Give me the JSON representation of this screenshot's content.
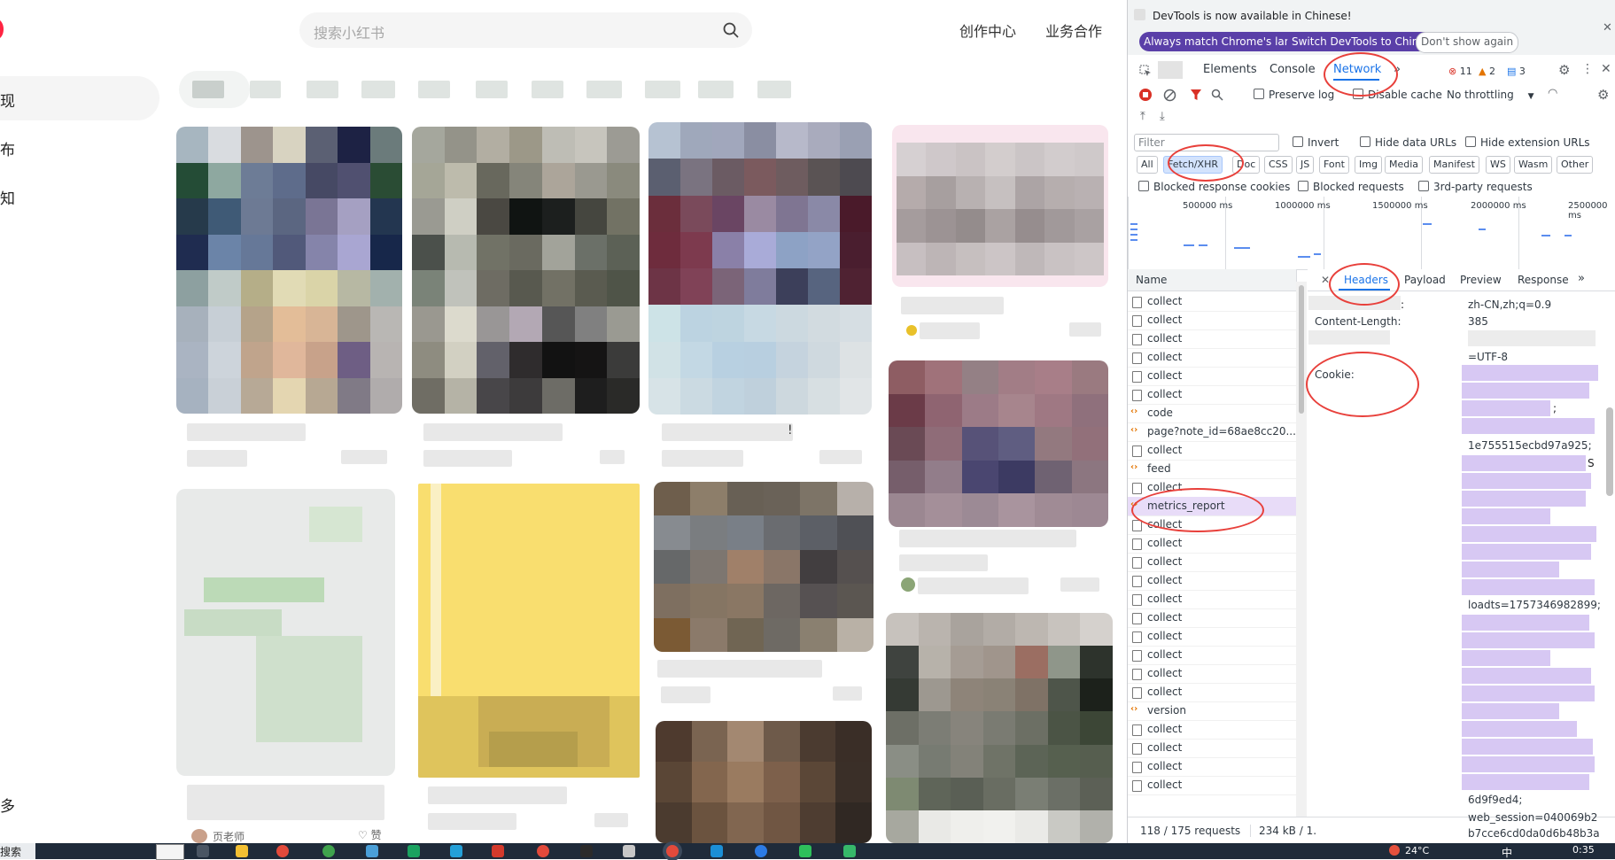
{
  "web": {
    "search": {
      "placeholder": "搜索小红书"
    },
    "top_links": [
      "创作中心",
      "业务合作"
    ],
    "sidebar_fragments": [
      "现",
      "布",
      "知",
      "多"
    ],
    "card_fragments": [
      "!",
      "页老师",
      "赞"
    ]
  },
  "devtools": {
    "infobar": {
      "message": "DevTools is now available in Chinese!",
      "btn_match": "Always match Chrome's language",
      "btn_switch": "Switch DevTools to Chinese",
      "btn_dont": "Don't show again",
      "close": "✕"
    },
    "tabs": {
      "elements": "Elements",
      "console": "Console",
      "network": "Network",
      "more": "»"
    },
    "badges": {
      "errors": "11",
      "warnings": "2",
      "messages": "3"
    },
    "toolbar": {
      "preserve_log": "Preserve log",
      "disable_cache": "Disable cache",
      "throttling": "No throttling"
    },
    "filter": {
      "placeholder": "Filter",
      "invert": "Invert",
      "hide_data_urls": "Hide data URLs",
      "hide_ext_urls": "Hide extension URLs",
      "types": [
        "All",
        "Fetch/XHR",
        "Doc",
        "CSS",
        "JS",
        "Font",
        "Img",
        "Media",
        "Manifest",
        "WS",
        "Wasm",
        "Other"
      ],
      "blocked_cookies": "Blocked response cookies",
      "blocked_requests": "Blocked requests",
      "third_party": "3rd-party requests"
    },
    "timeline_ticks": [
      "500000 ms",
      "1000000 ms",
      "1500000 ms",
      "2000000 ms",
      "2500000 ms"
    ],
    "requests": {
      "column": "Name",
      "rows": [
        {
          "name": "collect",
          "type": "doc"
        },
        {
          "name": "collect",
          "type": "doc"
        },
        {
          "name": "collect",
          "type": "doc"
        },
        {
          "name": "collect",
          "type": "doc"
        },
        {
          "name": "collect",
          "type": "doc"
        },
        {
          "name": "collect",
          "type": "doc"
        },
        {
          "name": "code",
          "type": "xhr"
        },
        {
          "name": "page?note_id=68ae8cc20...",
          "type": "xhr"
        },
        {
          "name": "collect",
          "type": "doc"
        },
        {
          "name": "feed",
          "type": "xhr"
        },
        {
          "name": "collect",
          "type": "doc"
        },
        {
          "name": "metrics_report",
          "type": "xhr",
          "selected": true
        },
        {
          "name": "collect",
          "type": "doc"
        },
        {
          "name": "collect",
          "type": "doc"
        },
        {
          "name": "collect",
          "type": "doc"
        },
        {
          "name": "collect",
          "type": "doc"
        },
        {
          "name": "collect",
          "type": "doc"
        },
        {
          "name": "collect",
          "type": "doc"
        },
        {
          "name": "collect",
          "type": "doc"
        },
        {
          "name": "collect",
          "type": "doc"
        },
        {
          "name": "collect",
          "type": "doc"
        },
        {
          "name": "collect",
          "type": "doc"
        },
        {
          "name": "version",
          "type": "xhr"
        },
        {
          "name": "collect",
          "type": "doc"
        },
        {
          "name": "collect",
          "type": "doc"
        },
        {
          "name": "collect",
          "type": "doc"
        },
        {
          "name": "collect",
          "type": "doc"
        }
      ],
      "status": "118 / 175 requests",
      "transferred": "234 kB / 1."
    },
    "detail_tabs": {
      "close": "✕",
      "headers": "Headers",
      "payload": "Payload",
      "preview": "Preview",
      "response": "Response",
      "more": "»"
    },
    "headers": {
      "accept_language_sep": ":",
      "accept_language_val": "zh-CN,zh;q=0.9",
      "content_length_key": "Content-Length:",
      "content_length_val": "385",
      "content_type_val": "=UTF-8",
      "cookie_key": "Cookie:",
      "cookie_fragments": [
        {
          "text": ";"
        },
        {
          "text": "1e755515ecbd97a925;"
        },
        {
          "text": "S"
        },
        {
          "text": "loadts=1757346982899;"
        },
        {
          "text": "6d9f9ed4;"
        },
        {
          "text": "web_session=040069b2"
        },
        {
          "text": "b7cce6cd0da0d6b48b3a"
        }
      ]
    }
  },
  "taskbar": {
    "weather": "24°C",
    "ime": "中",
    "time": "0:35",
    "search_fragment": "搜索"
  }
}
